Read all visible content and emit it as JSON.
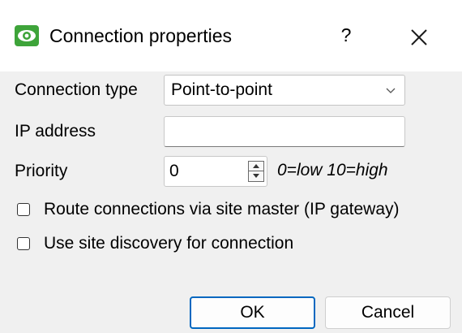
{
  "window": {
    "title": "Connection properties",
    "help_label": "?",
    "app_icon": "eye-icon",
    "close_icon": "close-icon"
  },
  "form": {
    "connection_type": {
      "label": "Connection type",
      "value": "Point-to-point"
    },
    "ip_address": {
      "label": "IP address",
      "value": ""
    },
    "priority": {
      "label": "Priority",
      "value": "0",
      "hint": "0=low 10=high"
    },
    "route_via_master": {
      "label": "Route connections via site master (IP gateway)",
      "checked": false
    },
    "site_discovery": {
      "label": "Use site discovery for connection",
      "checked": false
    }
  },
  "buttons": {
    "ok_label": "OK",
    "cancel_label": "Cancel"
  },
  "colors": {
    "accent": "#0067c0",
    "icon_green": "#3ea43a",
    "background": "#f0f0f0"
  }
}
